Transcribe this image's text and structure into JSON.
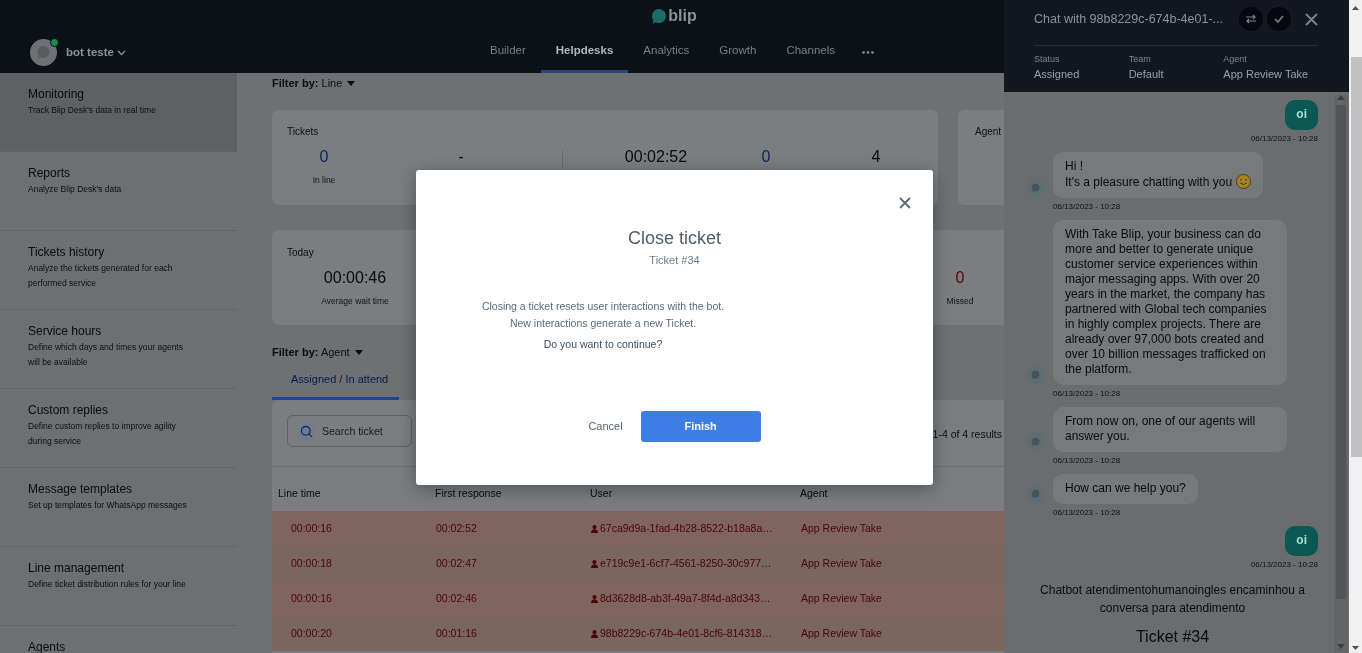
{
  "topbar": {
    "logo": "blip",
    "account": {
      "name": "bot teste",
      "online": true
    },
    "nav": [
      {
        "label": "Builder",
        "selected": false
      },
      {
        "label": "Helpdesks",
        "selected": true
      },
      {
        "label": "Analytics",
        "selected": false
      },
      {
        "label": "Growth",
        "selected": false
      },
      {
        "label": "Channels",
        "selected": false
      }
    ]
  },
  "sidebar": {
    "items": [
      {
        "title": "Monitoring",
        "description": "Track Blip Desk's data in real time",
        "selected": true
      },
      {
        "title": "Reports",
        "description": "Analyze Blip Desk's data",
        "selected": false
      },
      {
        "title": "Tickets history",
        "description": "Analyze the tickets generated for each performed service",
        "selected": false
      },
      {
        "title": "Service hours",
        "description": "Define which days and times your agents will be available",
        "selected": false
      },
      {
        "title": "Custom replies",
        "description": "Define custom replies to improve agility during service",
        "selected": false
      },
      {
        "title": "Message templates",
        "description": "Set up templates for WhatsApp messages",
        "selected": false
      },
      {
        "title": "Line management",
        "description": "Define ticket distribution rules for your line",
        "selected": false
      },
      {
        "title": "Agents",
        "selected": false
      }
    ]
  },
  "main": {
    "line_filter": "**Filter by:** Line",
    "tickets_card": {
      "title": "Tickets",
      "groups": [
        [
          {
            "value": "0",
            "label": "In line",
            "kind": "link"
          },
          {
            "value": "-",
            "kind": "plain"
          }
        ],
        [
          {
            "value": "00:02:52",
            "kind": "plain"
          },
          {
            "value": "0",
            "kind": "link"
          },
          {
            "value": "4",
            "kind": "plain"
          }
        ]
      ]
    },
    "agents_card": {
      "title": "Agent"
    },
    "today_card": {
      "title": "Today",
      "groups": [
        [
          {
            "value": "00:00:46",
            "label": "Average wait time",
            "kind": "plain"
          }
        ],
        [
          {
            "value": "0",
            "label": "Missed",
            "kind": "alert"
          }
        ]
      ]
    },
    "agent_filter": "**Filter by:** Agent",
    "tabs": [
      {
        "label": "Assigned / In attend",
        "selected": true
      }
    ],
    "search": {
      "placeholder": "Search ticket"
    },
    "results": "1-4 of 4 results",
    "table": {
      "columns": [
        "Line time",
        "First response",
        "User",
        "Agent"
      ],
      "rows": [
        {
          "overdue": true,
          "line_time": "00:00:16",
          "first_response": "00:02:52",
          "user": "67ca9d9a-1fad-4b28-8522-b18a8a…",
          "agent": "App Review Take"
        },
        {
          "overdue": true,
          "line_time": "00:00:18",
          "first_response": "00:02:47",
          "user": "e719c9e1-6cf7-4561-8250-30c977…",
          "agent": "App Review Take"
        },
        {
          "overdue": true,
          "line_time": "00:00:16",
          "first_response": "00:02:46",
          "user": "8d3628d8-ab3f-49a7-8f4d-a8d343…",
          "agent": "App Review Take"
        },
        {
          "overdue": true,
          "line_time": "00:00:20",
          "first_response": "00:01:16",
          "user": "98b8229c-674b-4e01-8cf6-814318…",
          "agent": "App Review Take"
        }
      ]
    }
  },
  "chat": {
    "title": "Chat with 98b8229c-674b-4e01-...",
    "details": [
      {
        "label": "Status",
        "value": "Assigned"
      },
      {
        "label": "Team",
        "value": "Default"
      },
      {
        "label": "Agent",
        "value": "App Review Take"
      }
    ],
    "messages": [
      {
        "kind": "sent",
        "text": "oi",
        "time": "06/13/2023 - 10:28",
        "emoji": false
      },
      {
        "kind": "received",
        "text": "Hi !\nIt's a pleasure chatting with you",
        "time": "06/13/2023 - 10:28",
        "emoji": true
      },
      {
        "kind": "received",
        "text": "With Take Blip, your business can do more and better to generate unique customer service experiences within major messaging apps. With over 20 years in the market, the company has partnered with Global tech companies in highly complex projects. There are already over 97,000 bots created and over 10 billion messages trafficked on the platform.",
        "time": "06/13/2023 - 10:28",
        "emoji": false
      },
      {
        "kind": "received",
        "text": "From now on, one of our agents will answer you.",
        "time": "06/13/2023 - 10:28",
        "emoji": false
      },
      {
        "kind": "received",
        "text": "How can we help you?",
        "time": "06/13/2023 - 10:28",
        "emoji": false
      },
      {
        "kind": "sent",
        "text": "oi",
        "time": "06/13/2023 - 10:28",
        "emoji": false
      }
    ],
    "notice": "Chatbot atendimentohumanoingles encaminhou a conversa para atendimento",
    "ticket": "Ticket #34"
  },
  "modal": {
    "title": "Close ticket",
    "subtitle": "Ticket #34",
    "lines": [
      "Closing a ticket resets user interactions with the bot.",
      "New interactions generate a new Ticket."
    ],
    "question": "Do you want to continue?",
    "buttons": [
      {
        "label": "Cancel",
        "kind": "text"
      },
      {
        "label": "Finish",
        "kind": "primary"
      }
    ]
  }
}
